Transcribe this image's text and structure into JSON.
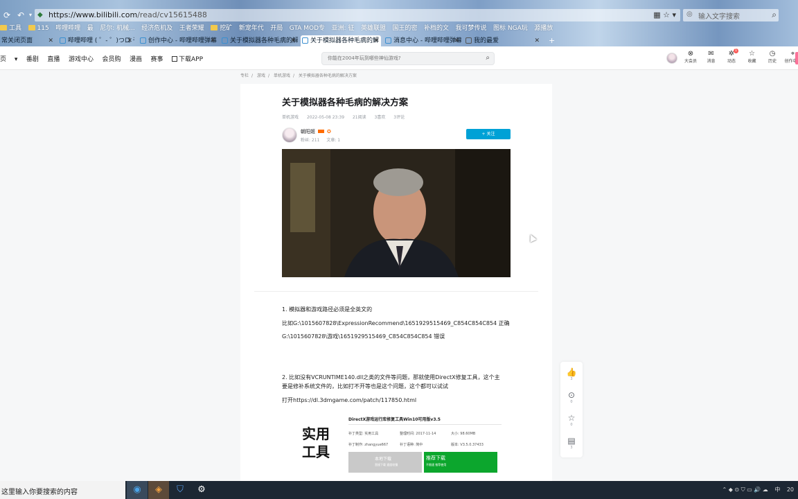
{
  "browser": {
    "url_host": "https://www.bilibili.com",
    "url_path": "/read/cv15615488",
    "search_placeholder": "输入文字搜索",
    "bookmarks": [
      "工具",
      "115",
      "哔哩哔哩",
      "最",
      "尼尔: 机械...",
      "经济危机及",
      "王者荣耀",
      "挖矿",
      "新宠年代",
      "开局",
      "GTA MOD专",
      "亚洲: 征",
      "英雄联盟",
      "国王的密",
      "补档的文",
      "我可梦传说",
      "图标 NGA玩",
      "源播放"
    ],
    "tabs": [
      {
        "label": "常关闭页面"
      },
      {
        "label": "哔哩哔哩 ( ゜- ゜)つロ 干"
      },
      {
        "label": "创作中心 - 哔哩哔哩弹幕"
      },
      {
        "label": "关于模拟器各种毛病的解"
      },
      {
        "label": "关于模拟器各种毛病的解"
      },
      {
        "label": "消息中心 - 哔哩哔哩弹幕"
      },
      {
        "label": "我的最爱"
      }
    ]
  },
  "header": {
    "nav": [
      "页",
      "番剧",
      "直播",
      "游戏中心",
      "会员购",
      "漫画",
      "赛事",
      "下载APP"
    ],
    "search_placeholder": "你能在2004年玩到哪些神仙游戏?",
    "icons": [
      {
        "label": "大会员",
        "icon": "vip-icon"
      },
      {
        "label": "消息",
        "icon": "message-icon"
      },
      {
        "label": "动态",
        "icon": "dynamic-icon",
        "badge": "1"
      },
      {
        "label": "收藏",
        "icon": "favorite-icon"
      },
      {
        "label": "历史",
        "icon": "history-icon"
      },
      {
        "label": "创作中心",
        "icon": "creator-icon"
      }
    ]
  },
  "breadcrumb": [
    "专栏",
    "游戏",
    "单机游戏",
    "关于模拟器各种毛病的解决方案"
  ],
  "article": {
    "title": "关于模拟器各种毛病的解决方案",
    "category": "单机游戏",
    "date": "2022-05-08 23:39",
    "views": "21阅读",
    "likes": "3喜欢",
    "comments": "3评论",
    "author": "朝阳姬",
    "fans": "粉丝: 211",
    "articles": "文章: 1",
    "follow_label": "+ 关注",
    "para1": "1. 模拟器和游戏路径必须是全英文的",
    "para2": "比如G:\\1015607828\\ExpressionRecommend\\1651929515469_C854C854C854 正确",
    "para3": "G:\\1015607828\\游戏\\1651929515469_C854C854C854 错误",
    "para4a": "2. 比如没有VCRUNTIME140.dll之类的文件等问题，那就使用DirectX修复工具，这个主",
    "para4b": "要是修补系统文件的，比如打不开等也是这个问题，这个都可以试试",
    "para5": "打开https://dl.3dmgame.com/patch/117850.html",
    "card": {
      "left_text_1": "实用",
      "left_text_2": "工具",
      "title": "DirectX游戏运行库修复工具Win10可用版v3.5",
      "row1": [
        "补丁类型: 实用工具",
        "整理时间: 2017-11-14",
        "大小: 98.60MB"
      ],
      "row2": [
        "补丁制作: zhangyue667",
        "补丁语种: 简中",
        "版本: V3.5.0.37433"
      ],
      "btn1": "本地下载",
      "btn1_sub": "直接下载 速度较慢",
      "btn2": "推荐下载",
      "btn2_sub": "不限速 推荐使用"
    }
  },
  "sidebar_actions": [
    {
      "name": "like",
      "icon": "thumbs-up-icon",
      "count": "3"
    },
    {
      "name": "coin",
      "icon": "coin-icon",
      "count": "0"
    },
    {
      "name": "favorite",
      "icon": "star-icon",
      "count": "0"
    },
    {
      "name": "comment",
      "icon": "comment-icon",
      "count": "3"
    }
  ],
  "taskbar": {
    "search_text": "这里输入你要搜索的内容",
    "tray": [
      "中",
      "20"
    ]
  }
}
